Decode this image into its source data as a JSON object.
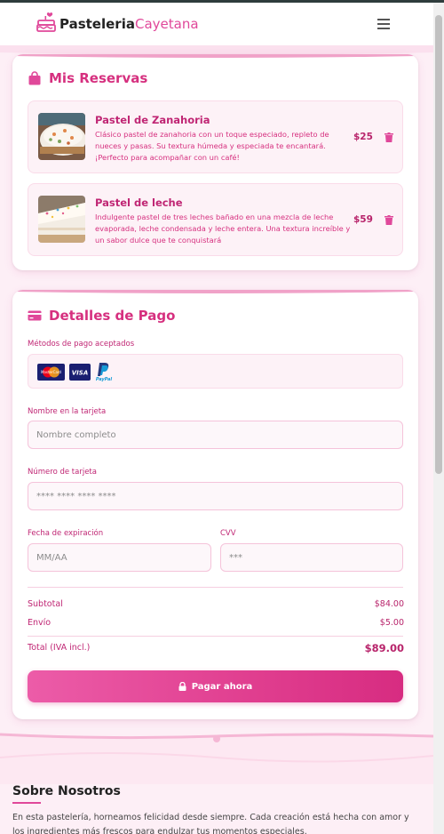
{
  "header": {
    "brand_bold": "Pasteleria",
    "brand_light": "Cayetana",
    "logo_icon": "cake-icon",
    "menu_icon": "hamburger-menu-icon"
  },
  "reservations": {
    "title": "Mis Reservas",
    "icon": "shopping-bag-icon",
    "items": [
      {
        "name": "Pastel de Zanahoria",
        "description": "Clásico pastel de zanahoria con un toque especiado, repleto de nueces y pasas. Su textura húmeda y especiada te encantará. ¡Perfecto para acompañar con un café!",
        "price": "$25",
        "icon": "trash-icon"
      },
      {
        "name": "Pastel de leche",
        "description": "Indulgente pastel de tres leches bañado en una mezcla de leche evaporada, leche condensada y leche entera. Una textura increíble y un sabor dulce que te conquistará",
        "price": "$59",
        "icon": "trash-icon"
      }
    ]
  },
  "payment": {
    "title": "Detalles de Pago",
    "icon": "credit-card-icon",
    "methods_label": "Métodos de pago aceptados",
    "methods": [
      "Mastercard",
      "VISA",
      "PayPal"
    ],
    "name_label": "Nombre en la tarjeta",
    "name_placeholder": "Nombre completo",
    "number_label": "Número de tarjeta",
    "number_placeholder": "**** **** **** ****",
    "expiry_label": "Fecha de expiración",
    "expiry_placeholder": "MM/AA",
    "cvv_label": "CVV",
    "cvv_placeholder": "***",
    "subtotal_label": "Subtotal",
    "subtotal_value": "$84.00",
    "shipping_label": "Envío",
    "shipping_value": "$5.00",
    "total_label": "Total (IVA incl.)",
    "total_value": "$89.00",
    "pay_button": "Pagar ahora"
  },
  "about": {
    "title": "Sobre Nosotros",
    "text": "En esta pastelería, horneamos felicidad desde siempre. Cada creación está hecha con amor y los ingredientes más frescos para endulzar tus momentos especiales."
  },
  "colors": {
    "accent": "#e0489a",
    "accent_dark": "#c02674",
    "background": "#fdeff6"
  }
}
